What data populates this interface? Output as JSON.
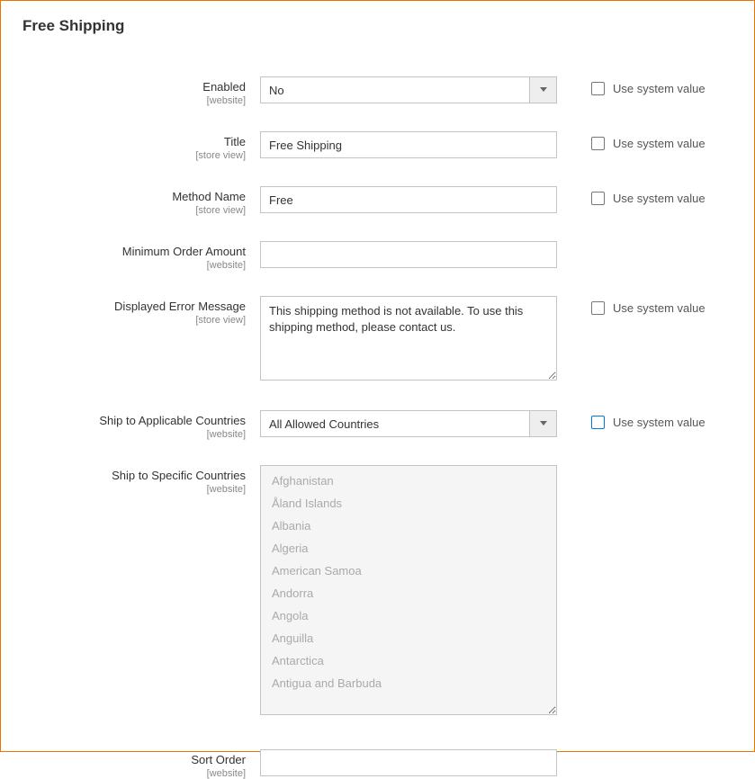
{
  "section_title": "Free Shipping",
  "scopes": {
    "website": "website",
    "store_view": "store view"
  },
  "use_system": "Use system value",
  "fields": {
    "enabled": {
      "label": "Enabled",
      "value": "No"
    },
    "title": {
      "label": "Title",
      "value": "Free Shipping"
    },
    "method_name": {
      "label": "Method Name",
      "value": "Free"
    },
    "min_order": {
      "label": "Minimum Order Amount",
      "value": ""
    },
    "error_msg": {
      "label": "Displayed Error Message",
      "value": "This shipping method is not available. To use this shipping method, please contact us."
    },
    "applicable": {
      "label": "Ship to Applicable Countries",
      "value": "All Allowed Countries"
    },
    "specific": {
      "label": "Ship to Specific Countries"
    },
    "sort_order": {
      "label": "Sort Order",
      "value": ""
    }
  },
  "countries": [
    "Afghanistan",
    "Åland Islands",
    "Albania",
    "Algeria",
    "American Samoa",
    "Andorra",
    "Angola",
    "Anguilla",
    "Antarctica",
    "Antigua and Barbuda"
  ]
}
